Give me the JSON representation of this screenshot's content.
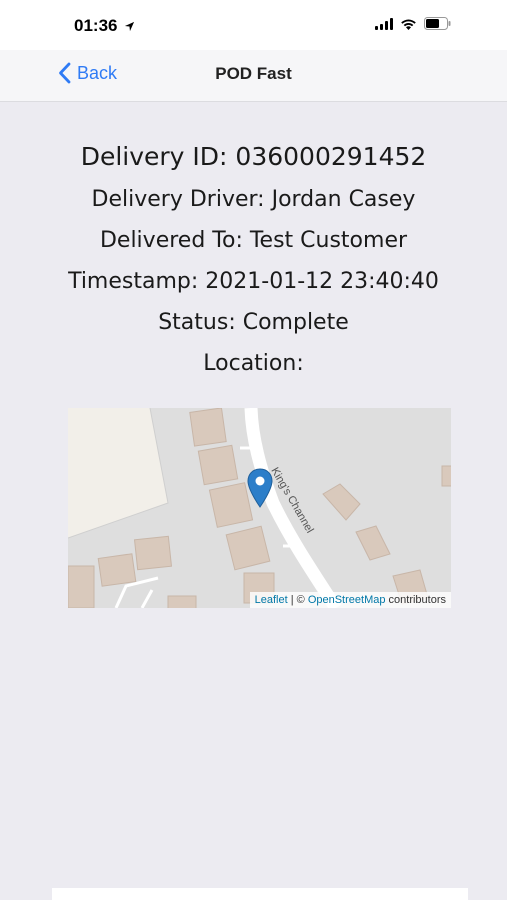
{
  "status_bar": {
    "time": "01:36",
    "icons": [
      "location-arrow-icon",
      "signal-icon",
      "wifi-icon",
      "battery-icon"
    ]
  },
  "nav": {
    "back_label": "Back",
    "title": "POD Fast",
    "accent_color": "#2f7bf5"
  },
  "delivery": {
    "id_line": "Delivery ID: 036000291452",
    "driver_line": "Delivery Driver: Jordan Casey",
    "delivered_to_line": "Delivered To: Test Customer",
    "timestamp_line": "Timestamp: 2021-01-12 23:40:40",
    "status_line": "Status: Complete",
    "location_label": "Location:"
  },
  "map": {
    "street_label": "King's Channel",
    "marker_icon": "map-pin-icon",
    "attribution": {
      "leaflet": "Leaflet",
      "separator": " | © ",
      "osm": "OpenStreetMap",
      "suffix": " contributors"
    }
  }
}
